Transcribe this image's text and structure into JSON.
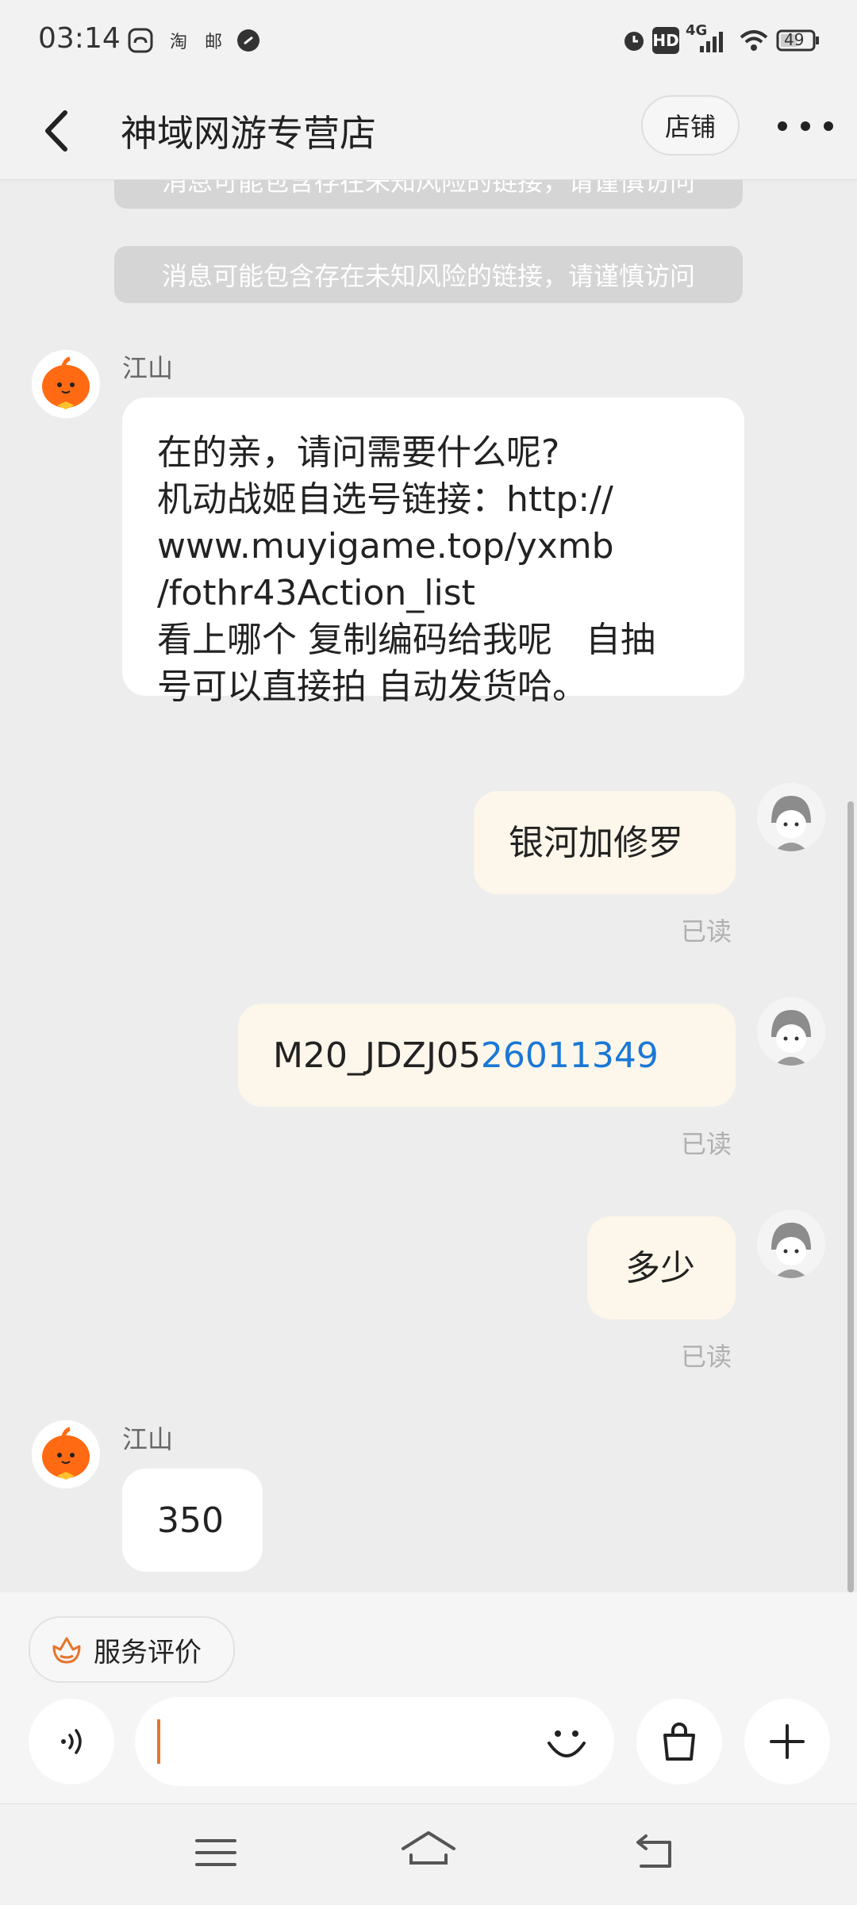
{
  "status_bar": {
    "time": "03:14",
    "left_icons": [
      "cloud-icon",
      "tao-icon",
      "mail-icon",
      "app-icon"
    ],
    "tao_text": "淘",
    "mail_text": "邮",
    "hd": "HD",
    "network": "4G",
    "battery": "49"
  },
  "header": {
    "title": "神域网游专营店",
    "shop_label": "店铺"
  },
  "chat": {
    "notice_text": "消息可能包含存在未知风险的链接，请谨慎访问",
    "messages": [
      {
        "sender": "江山",
        "lines": [
          "在的亲，请问需要什么呢?",
          "机动战姬自选号链接：http://",
          "www.muyigame.top/yxmb",
          "/fothr43Action_list",
          "看上哪个 复制编码给我呢   自抽",
          "号可以直接拍 自动发货哈。"
        ]
      },
      {
        "text": "银河加修罗",
        "status": "已读"
      },
      {
        "text_prefix": "M20_JDZJ05",
        "text_link": "26011349",
        "status": "已读"
      },
      {
        "text": "多少",
        "status": "已读"
      },
      {
        "sender": "江山",
        "text": "350"
      }
    ]
  },
  "bottom": {
    "evaluate_label": "服务评价",
    "input_value": ""
  },
  "colors": {
    "accent": "#e8742a",
    "link": "#1a78d6",
    "bubble_out": "#fdf6ea",
    "bubble_in": "#ffffff",
    "chat_bg": "#ededed"
  }
}
